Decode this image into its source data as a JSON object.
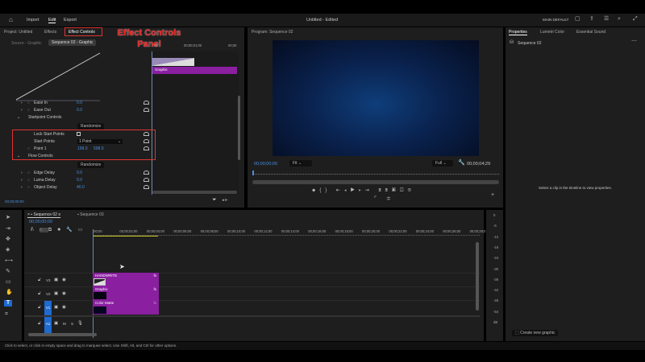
{
  "menu": {
    "home_icon": "home-icon",
    "items": [
      "Import",
      "Edit",
      "Export"
    ],
    "active": "Edit",
    "title": "Untitled - Edited",
    "workspace": "MAIN DEFAULT"
  },
  "left_panel": {
    "tabs": [
      "Project: Untitled",
      "Effects",
      "Effect Controls"
    ],
    "active_tab": "Effect Controls",
    "source_tabs": [
      "Source - Graphic",
      "Sequence 02 - Graphic"
    ],
    "ruler": [
      ":00",
      "00;00;01;00",
      "00;00"
    ],
    "clip_label": "Graphic",
    "rows": [
      {
        "label": "Ease In",
        "value": "0.0"
      },
      {
        "label": "Ease Out",
        "value": "0.0"
      },
      {
        "label": "Startpoint Controls"
      },
      {
        "label": "Lock Start Points"
      },
      {
        "label": "Start Points",
        "value": "1 Point"
      },
      {
        "label": "Point 1",
        "value": "158.0",
        "value2": "598.0"
      },
      {
        "label": "Flow Controls"
      },
      {
        "label": "Edge Delay",
        "value": "0.0"
      },
      {
        "label": "Luma Delay",
        "value": "0.0"
      },
      {
        "label": "Object Delay",
        "value": "40.0"
      }
    ],
    "randomize": "Randomize",
    "timecode": "00;00;00;00",
    "annotation": "Effect Controls Panel",
    "annotation_color": "#e02020"
  },
  "program": {
    "title": "Program: Sequence 02",
    "timecode": "00;00;00;00",
    "fit": "Fit",
    "quality": "Full",
    "duration": "00;00;04;29",
    "accent": "#4a8fe0"
  },
  "properties": {
    "tabs": [
      "Properties",
      "Lumetri Color",
      "Essential Sound"
    ],
    "sequence": "Sequence 02",
    "message": "Select a clip in the timeline to view properties.",
    "create": "Create new graphic"
  },
  "timeline": {
    "tabs": [
      "Sequence 02",
      "Sequence 03"
    ],
    "timecode": "00;00;00;00",
    "ruler": [
      ":00;00",
      "00;00;02;00",
      "00;00;04;00",
      "00;00;06;00",
      "00;00;08;00",
      "00;00;10;00",
      "00;00;12;00",
      "00;00;14;00",
      "00;00;16;00",
      "00;00;18;00",
      "00;00;20;00",
      "00;00;22;00",
      "00;00;24;00",
      "00;00;26;00",
      "00;00;28;0"
    ],
    "tracks": [
      "V3",
      "V2",
      "V1",
      "A1"
    ],
    "audio_buttons": [
      "M",
      "S"
    ],
    "clips": [
      "HANDWRITE",
      "Graphic",
      "Color Matte"
    ],
    "clip_color": "#8a1fa0"
  },
  "meter": [
    "0",
    "-6",
    "-12",
    "-18",
    "-24",
    "-30",
    "-36",
    "-42",
    "-48",
    "-54",
    "dB"
  ],
  "status": "Click to select, or click in empty space and drag to marquee select. Use Shift, Alt, and Ctrl for other options."
}
